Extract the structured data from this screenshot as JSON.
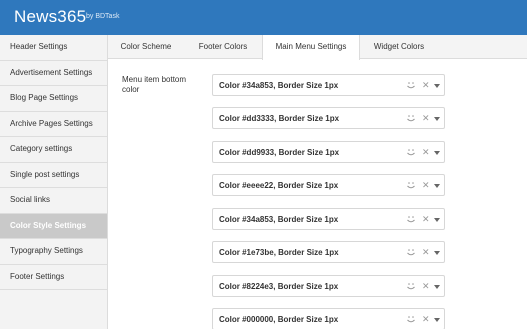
{
  "header": {
    "brand": "News365",
    "by": "by BDTask"
  },
  "sidebar": {
    "items": [
      {
        "label": "Header Settings"
      },
      {
        "label": "Advertisement Settings"
      },
      {
        "label": "Blog Page Settings"
      },
      {
        "label": "Archive Pages Settings"
      },
      {
        "label": "Category settings"
      },
      {
        "label": "Single post settings"
      },
      {
        "label": "Social links"
      },
      {
        "label": "Color Style Settings",
        "active": true
      },
      {
        "label": "Typography Settings"
      },
      {
        "label": "Footer Settings"
      }
    ]
  },
  "tabs": [
    {
      "label": "Color Scheme"
    },
    {
      "label": "Footer Colors"
    },
    {
      "label": "Main Menu Settings",
      "active": true
    },
    {
      "label": "Widget Colors"
    }
  ],
  "main": {
    "field_label": "Menu item bottom color",
    "selects": [
      {
        "value": "Color #34a853, Border Size 1px"
      },
      {
        "value": "Color #dd3333, Border Size 1px"
      },
      {
        "value": "Color #dd9933, Border Size 1px"
      },
      {
        "value": "Color #eeee22, Border Size 1px"
      },
      {
        "value": "Color #34a853, Border Size 1px"
      },
      {
        "value": "Color #1e73be, Border Size 1px"
      },
      {
        "value": "Color #8224e3, Border Size 1px"
      },
      {
        "value": "Color #000000, Border Size 1px"
      }
    ],
    "icons": {
      "emoji": "smiley-icon",
      "clear": "close-icon",
      "dropdown": "chevron-down-icon"
    }
  },
  "colors": {
    "header_bg": "#2f78bd",
    "active_side_bg": "#c9c9c9"
  }
}
